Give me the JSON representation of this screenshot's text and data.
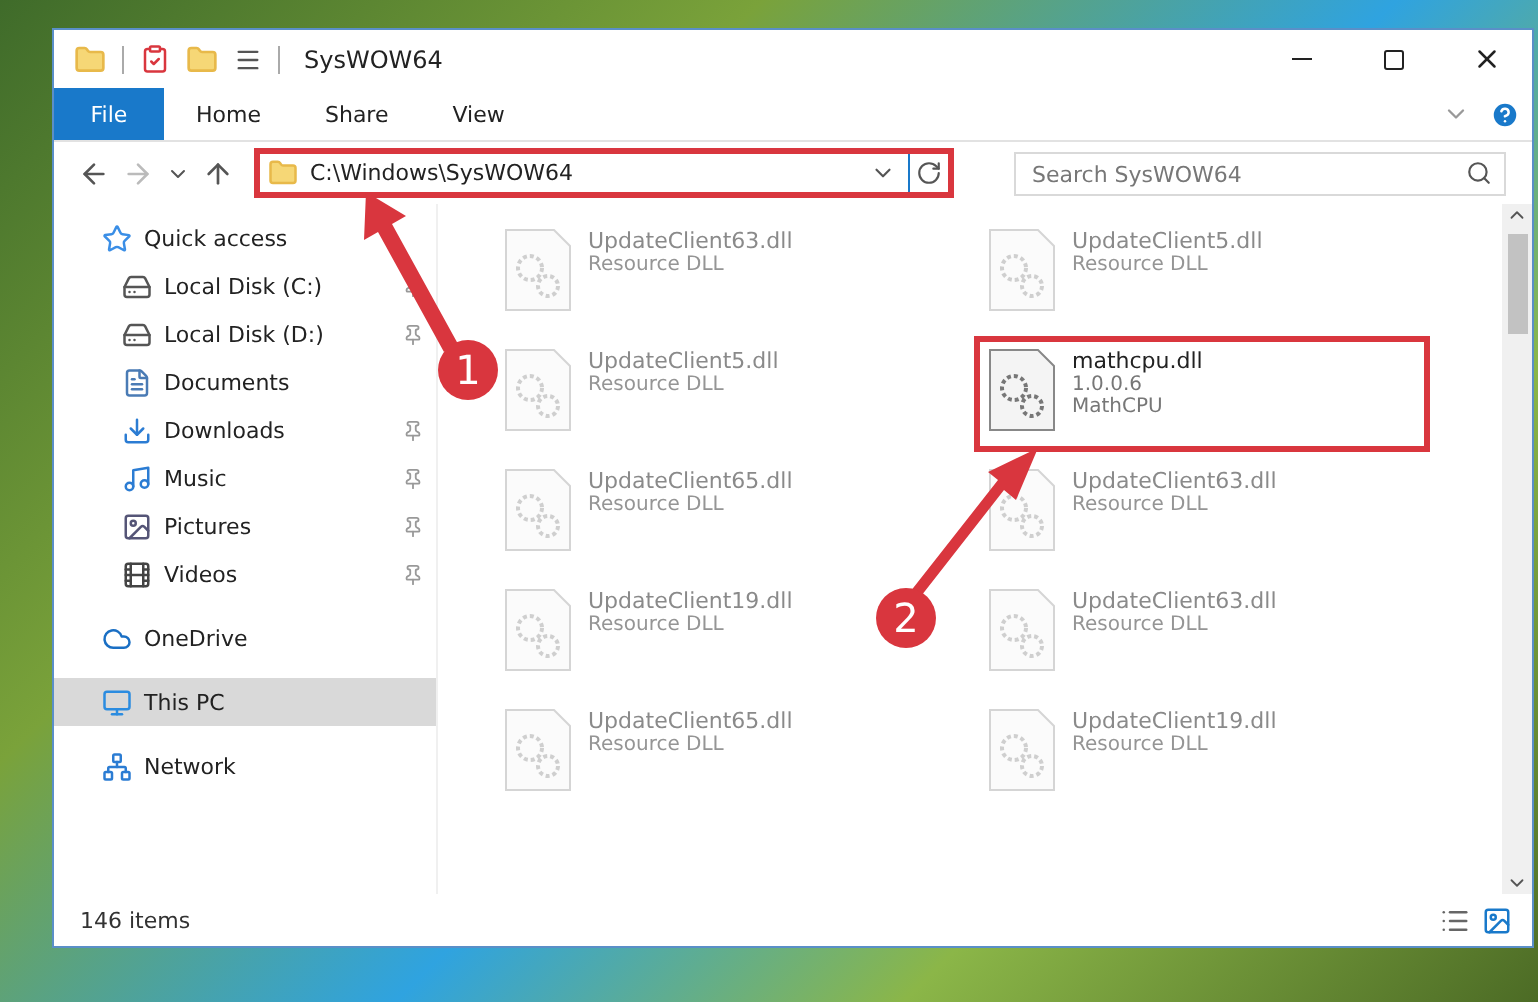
{
  "window": {
    "title": "SysWOW64"
  },
  "ribbon": {
    "file_button": "File",
    "tabs": [
      "Home",
      "Share",
      "View"
    ]
  },
  "address": {
    "path": "C:\\Windows\\SysWOW64",
    "highlighted": true
  },
  "search": {
    "placeholder": "Search SysWOW64"
  },
  "sidebar": {
    "items": [
      {
        "label": "Quick access",
        "kind": "star",
        "selected": false,
        "children": [
          {
            "label": "Local Disk (C:)",
            "kind": "disk",
            "selected": false,
            "pinned": true
          },
          {
            "label": "Local Disk (D:)",
            "kind": "disk",
            "selected": false,
            "pinned": true
          },
          {
            "label": "Documents",
            "kind": "documents",
            "selected": false,
            "pinned": false
          },
          {
            "label": "Downloads",
            "kind": "downloads",
            "selected": false,
            "pinned": true
          },
          {
            "label": "Music",
            "kind": "music",
            "selected": false,
            "pinned": true
          },
          {
            "label": "Pictures",
            "kind": "pictures",
            "selected": false,
            "pinned": true
          },
          {
            "label": "Videos",
            "kind": "videos",
            "selected": false,
            "pinned": true
          }
        ]
      },
      {
        "label": "OneDrive",
        "kind": "cloud",
        "selected": false
      },
      {
        "label": "This PC",
        "kind": "pc",
        "selected": true
      },
      {
        "label": "Network",
        "kind": "network",
        "selected": false
      }
    ]
  },
  "files": [
    {
      "name": "UpdateClient63.dll",
      "details": [
        "Resource DLL"
      ],
      "faded": true,
      "highlighted": false
    },
    {
      "name": "UpdateClient5.dll",
      "details": [
        "Resource DLL"
      ],
      "faded": true,
      "highlighted": false
    },
    {
      "name": "UpdateClient5.dll",
      "details": [
        "Resource DLL"
      ],
      "faded": true,
      "highlighted": false
    },
    {
      "name": "mathcpu.dll",
      "details": [
        "1.0.0.6",
        "MathCPU"
      ],
      "faded": false,
      "highlighted": true
    },
    {
      "name": "UpdateClient65.dll",
      "details": [
        "Resource DLL"
      ],
      "faded": true,
      "highlighted": false
    },
    {
      "name": "UpdateClient63.dll",
      "details": [
        "Resource DLL"
      ],
      "faded": true,
      "highlighted": false
    },
    {
      "name": "UpdateClient19.dll",
      "details": [
        "Resource DLL"
      ],
      "faded": true,
      "highlighted": false
    },
    {
      "name": "UpdateClient63.dll",
      "details": [
        "Resource DLL"
      ],
      "faded": true,
      "highlighted": false
    },
    {
      "name": "UpdateClient65.dll",
      "details": [
        "Resource DLL"
      ],
      "faded": true,
      "highlighted": false
    },
    {
      "name": "UpdateClient19.dll",
      "details": [
        "Resource DLL"
      ],
      "faded": true,
      "highlighted": false
    }
  ],
  "status_bar": {
    "item_count": "146 items"
  },
  "annotations": [
    {
      "number": "1"
    },
    {
      "number": "2"
    }
  ]
}
